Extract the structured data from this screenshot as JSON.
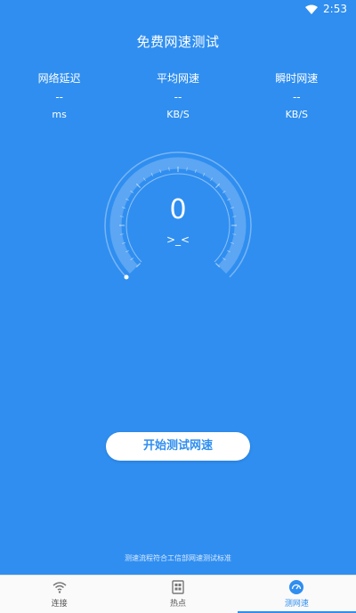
{
  "status_bar": {
    "time": "2:53"
  },
  "title": "免费网速测试",
  "stats": [
    {
      "label": "网络延迟",
      "value": "--",
      "unit": "ms"
    },
    {
      "label": "平均网速",
      "value": "--",
      "unit": "KB/S"
    },
    {
      "label": "瞬时网速",
      "value": "--",
      "unit": "KB/S"
    }
  ],
  "gauge": {
    "value": "0",
    "face": ">_<",
    "level": 0
  },
  "start_button": "开始测试网速",
  "footnote": "测速流程符合工信部网速测试标准",
  "nav": [
    {
      "label": "连接",
      "icon": "wifi-icon",
      "active": false
    },
    {
      "label": "热点",
      "icon": "hotspot-icon",
      "active": false
    },
    {
      "label": "测网速",
      "icon": "speedometer-icon",
      "active": true
    }
  ],
  "colors": {
    "background": "#2f8ef0",
    "accent": "#2f8ef0",
    "nav_bg": "#fafafa"
  }
}
